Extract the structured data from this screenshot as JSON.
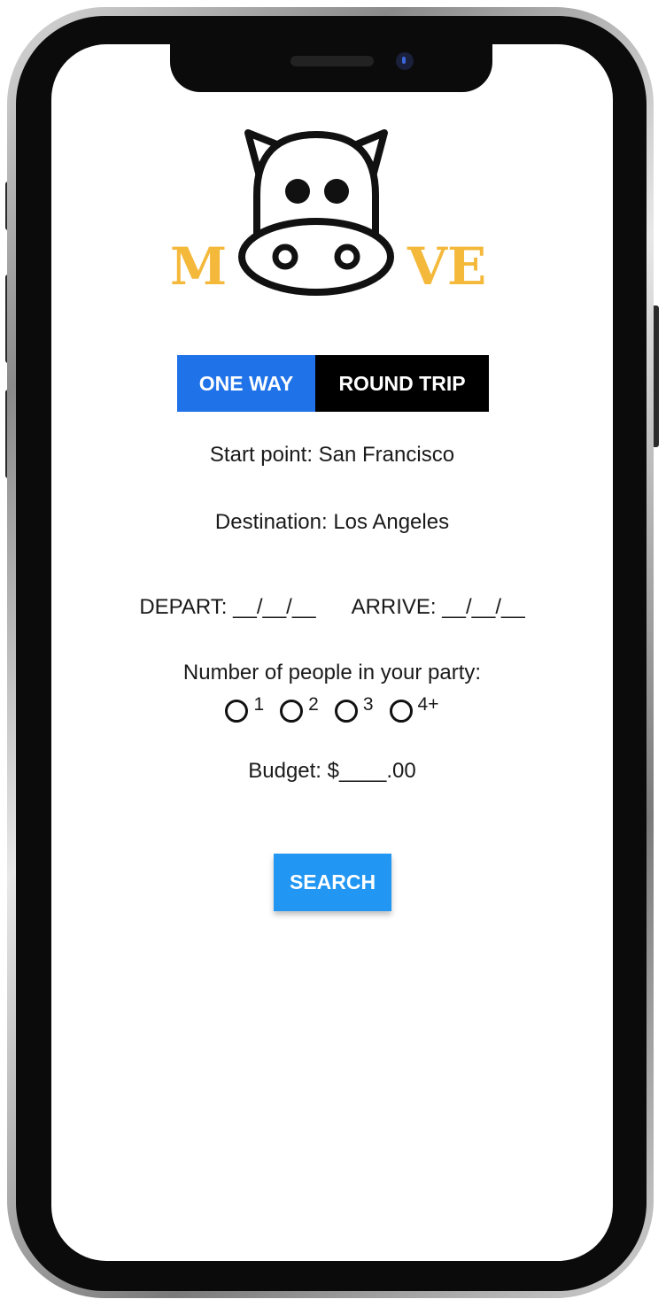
{
  "logo": {
    "letter_left": "M",
    "letter_right": "VE",
    "icon": "cow-head-icon",
    "accent_color": "#f4b83a"
  },
  "trip_toggle": {
    "one_way_label": "ONE WAY",
    "round_trip_label": "ROUND TRIP",
    "selected": "ONE WAY"
  },
  "form": {
    "start_point": "Start point: San Francisco",
    "destination": "Destination:  Los Angeles",
    "depart": "DEPART: __/__/__",
    "arrive": "ARRIVE: __/__/__",
    "party_label": "Number of people in your party:",
    "party_options": [
      "1",
      "2",
      "3",
      "4+"
    ],
    "budget": "Budget: $____.00"
  },
  "search_button": {
    "label": "SEARCH",
    "color": "#2196f3"
  }
}
